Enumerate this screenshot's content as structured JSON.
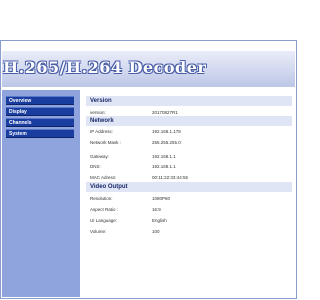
{
  "app": {
    "title": "H.265/H.264 Decoder"
  },
  "sidebar": {
    "items": [
      {
        "label": "Overview"
      },
      {
        "label": "Display"
      },
      {
        "label": "Channels"
      },
      {
        "label": "System"
      }
    ]
  },
  "main": {
    "sections": [
      {
        "heading": "Version",
        "rows": [
          {
            "label": "version:",
            "value": "20170827R1"
          }
        ]
      },
      {
        "heading": "Network",
        "rows": [
          {
            "label": "IP Address:",
            "value": "192.168.1.178"
          },
          {
            "label": "Network Mask :",
            "value": "255.255.255.0"
          },
          {
            "label": "Gateway:",
            "value": "192.168.1.1"
          },
          {
            "label": "DNS:",
            "value": "192.168.1.1"
          },
          {
            "label": "MAC Adress:",
            "value": "00:11:22:33:44:55"
          }
        ]
      },
      {
        "heading": "Video Output",
        "rows": [
          {
            "label": "Resolution:",
            "value": "1080P60"
          },
          {
            "label": "Aspect Ratio :",
            "value": "16:9"
          },
          {
            "label": "UI Language:",
            "value": "English"
          },
          {
            "label": "Volume:",
            "value": "100"
          }
        ]
      }
    ]
  },
  "colors": {
    "sidebar_bg": "#8fa3dc",
    "nav_item_bg": "#1a3da0",
    "section_bg": "#dfe5f5",
    "title_outline": "#4a5ea8"
  }
}
